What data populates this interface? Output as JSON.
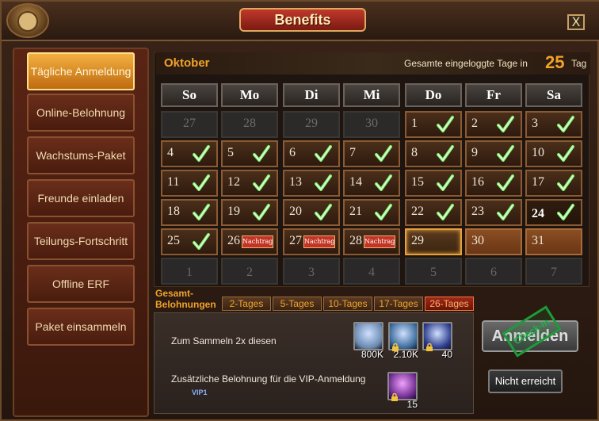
{
  "window": {
    "title": "Benefits",
    "close_label": "X"
  },
  "sidebar": {
    "items": [
      {
        "label": "Tägliche Anmeldung",
        "active": true
      },
      {
        "label": "Online-Belohnung",
        "active": false
      },
      {
        "label": "Wachstums-Paket",
        "active": false
      },
      {
        "label": "Freunde einladen",
        "active": false
      },
      {
        "label": "Teilungs-Fortschritt",
        "active": false
      },
      {
        "label": "Offline ERF",
        "active": false
      },
      {
        "label": "Paket einsammeln",
        "active": false
      }
    ]
  },
  "calendar": {
    "month": "Oktober",
    "login_days_label": "Gesamte eingeloggte Tage in",
    "login_days_count": "25",
    "login_days_unit": "Tag",
    "weekdays": [
      "So",
      "Mo",
      "Di",
      "Mi",
      "Do",
      "Fr",
      "Sa"
    ],
    "retro_label": "Nachtrag",
    "rows": [
      [
        {
          "n": "27",
          "s": "out"
        },
        {
          "n": "28",
          "s": "out"
        },
        {
          "n": "29",
          "s": "out"
        },
        {
          "n": "30",
          "s": "out"
        },
        {
          "n": "1",
          "s": "done"
        },
        {
          "n": "2",
          "s": "done"
        },
        {
          "n": "3",
          "s": "done"
        }
      ],
      [
        {
          "n": "4",
          "s": "done"
        },
        {
          "n": "5",
          "s": "done"
        },
        {
          "n": "6",
          "s": "done"
        },
        {
          "n": "7",
          "s": "done"
        },
        {
          "n": "8",
          "s": "done"
        },
        {
          "n": "9",
          "s": "done"
        },
        {
          "n": "10",
          "s": "done"
        }
      ],
      [
        {
          "n": "11",
          "s": "done"
        },
        {
          "n": "12",
          "s": "done"
        },
        {
          "n": "13",
          "s": "done"
        },
        {
          "n": "14",
          "s": "done"
        },
        {
          "n": "15",
          "s": "done"
        },
        {
          "n": "16",
          "s": "done"
        },
        {
          "n": "17",
          "s": "done"
        }
      ],
      [
        {
          "n": "18",
          "s": "done"
        },
        {
          "n": "19",
          "s": "done"
        },
        {
          "n": "20",
          "s": "done"
        },
        {
          "n": "21",
          "s": "done"
        },
        {
          "n": "22",
          "s": "done"
        },
        {
          "n": "23",
          "s": "done"
        },
        {
          "n": "24",
          "s": "next"
        }
      ],
      [
        {
          "n": "25",
          "s": "done"
        },
        {
          "n": "26",
          "s": "missed"
        },
        {
          "n": "27",
          "s": "missed"
        },
        {
          "n": "28",
          "s": "missed"
        },
        {
          "n": "29",
          "s": "today"
        },
        {
          "n": "30",
          "s": "future"
        },
        {
          "n": "31",
          "s": "future"
        }
      ],
      [
        {
          "n": "1",
          "s": "empty"
        },
        {
          "n": "2",
          "s": "empty"
        },
        {
          "n": "3",
          "s": "empty"
        },
        {
          "n": "4",
          "s": "empty"
        },
        {
          "n": "5",
          "s": "empty"
        },
        {
          "n": "6",
          "s": "empty"
        },
        {
          "n": "7",
          "s": "empty"
        }
      ]
    ]
  },
  "rewards": {
    "tabs_label": "Gesamt-Belohnungen",
    "tabs": [
      {
        "label": "2-Tages",
        "active": false
      },
      {
        "label": "5-Tages",
        "active": false
      },
      {
        "label": "10-Tages",
        "active": false
      },
      {
        "label": "17-Tages",
        "active": false
      },
      {
        "label": "26-Tages",
        "active": true
      }
    ],
    "collect_text": "Zum Sammeln 2x diesen",
    "vip_text": "Zusätzliche Belohnung für die VIP-Anmeldung",
    "vip_badge": "VIP1",
    "items": [
      {
        "name": "silver-chest-icon",
        "qty": "800K",
        "color": "#6a8ab0"
      },
      {
        "name": "gold-pack-icon",
        "qty": "2.10K",
        "color": "#3a6a9a"
      },
      {
        "name": "blue-crystal-icon",
        "qty": "40",
        "color": "#2a3a8a"
      }
    ],
    "vip_item": {
      "name": "purple-feather-icon",
      "qty": "15",
      "color": "#6a2a8a"
    }
  },
  "actions": {
    "signin_label": "Anmelden",
    "stamp_label": "Check-In",
    "not_reached_label": "Nicht erreicht"
  }
}
